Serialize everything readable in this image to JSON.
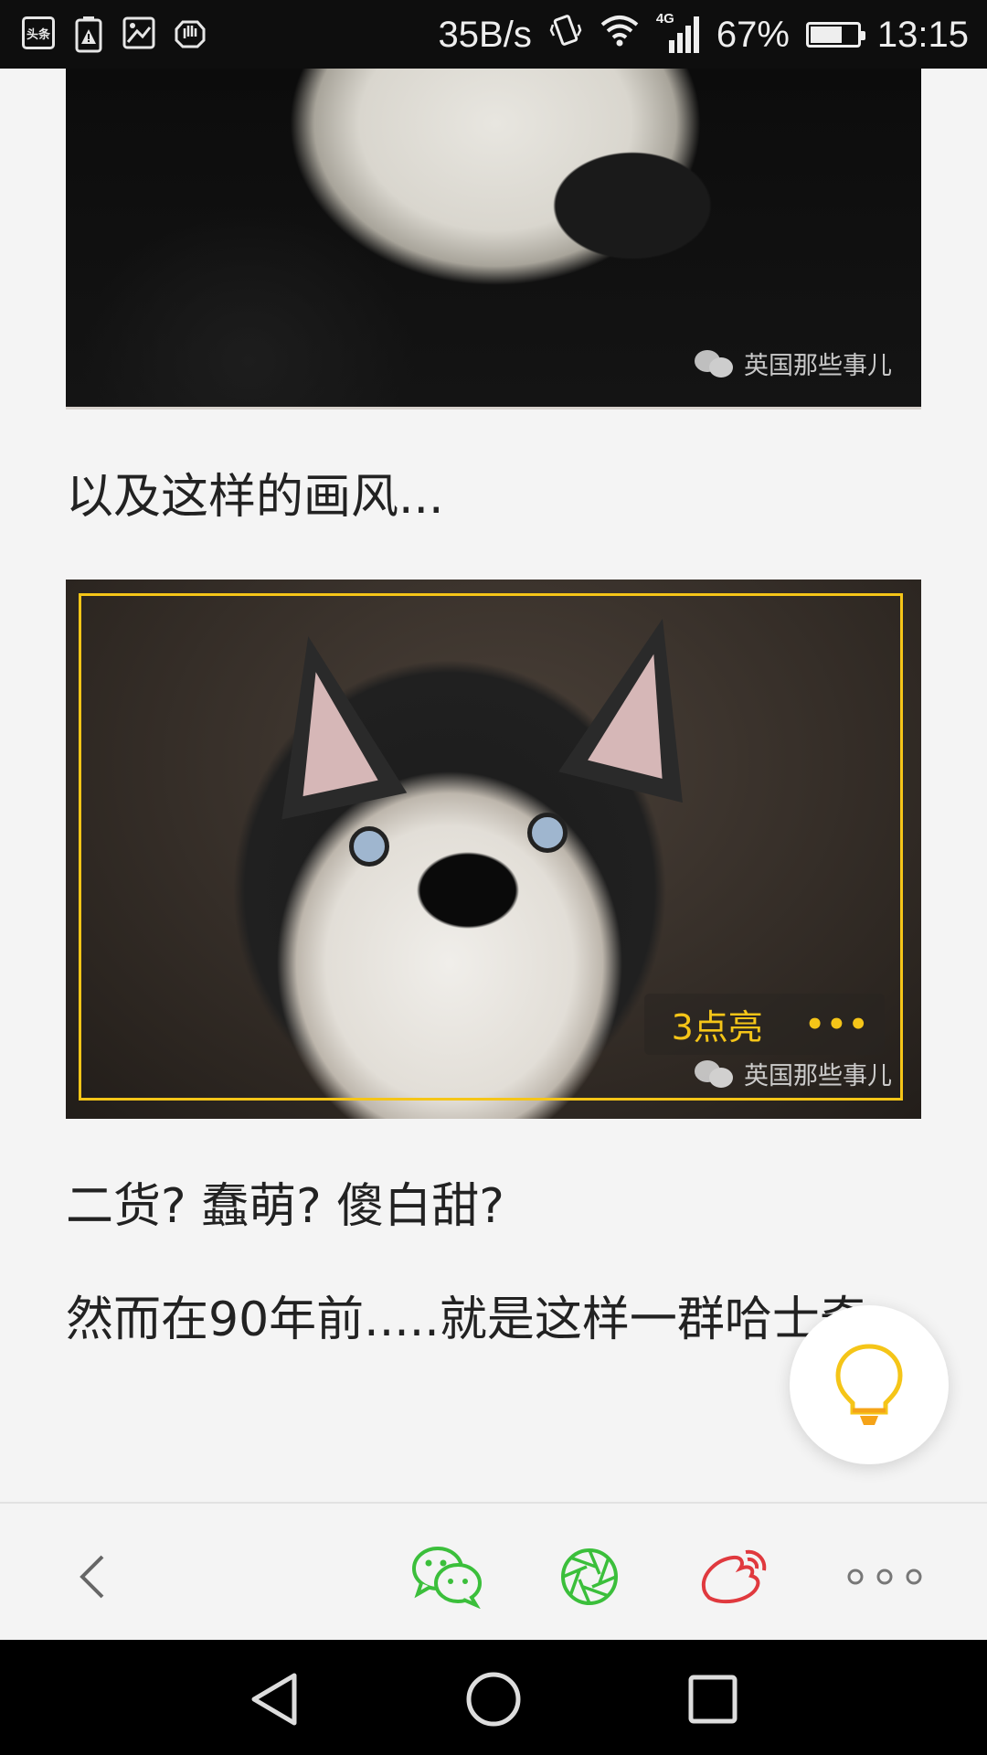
{
  "status_bar": {
    "left_icons": [
      "toutiao-icon",
      "battery-warning-icon",
      "image-icon",
      "hand-icon"
    ],
    "app_badge": "头条",
    "net_speed": "35B/s",
    "network_type": "4G",
    "battery_percent": "67%",
    "battery_level": 0.67,
    "time": "13:15"
  },
  "article": {
    "image1_watermark": "英国那些事儿",
    "paragraph1": "以及这样的画风...",
    "image2_watermark": "英国那些事儿",
    "image2_highlight_label": "3点亮",
    "image2_more_label": "•••",
    "paragraph2": "二货? 蠢萌? 傻白甜?",
    "paragraph3": "然而在90年前.....就是这样一群哈士奇..."
  },
  "floating_button": {
    "icon": "lightbulb-icon",
    "color": "#f5c518"
  },
  "action_bar": {
    "back_icon": "chevron-left-icon",
    "share_targets": [
      {
        "name": "wechat",
        "color": "#3bbf3b"
      },
      {
        "name": "moments",
        "color": "#3bbf3b"
      },
      {
        "name": "weibo",
        "color": "#e0393e"
      }
    ],
    "more_icon": "more-dots-icon"
  },
  "colors": {
    "accent": "#f5c518",
    "background": "#f4f4f4",
    "text": "#222222"
  },
  "nav_bar": {
    "buttons": [
      "back-triangle",
      "home-circle",
      "recents-square"
    ]
  }
}
